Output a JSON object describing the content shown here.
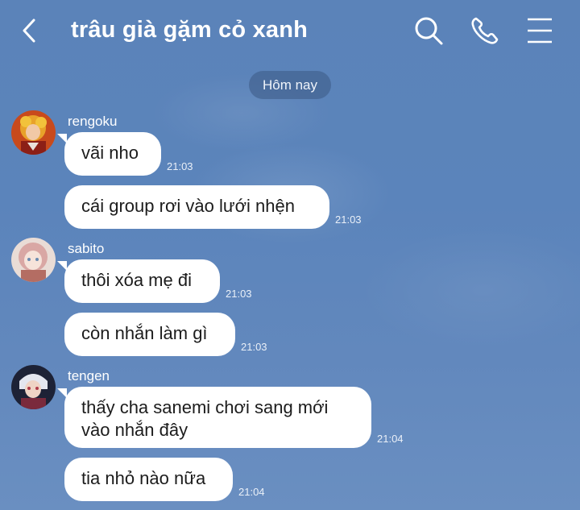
{
  "header": {
    "title": "trâu già gặm cỏ xanh",
    "icons": {
      "back": "chevron-left-icon",
      "search": "search-icon",
      "call": "phone-icon",
      "menu": "menu-icon"
    }
  },
  "date_divider": "Hôm nay",
  "messages": [
    {
      "sender": "rengoku",
      "text": "vãi nho",
      "time": "21:03"
    },
    {
      "text": "cái group rơi vào lưới nhện",
      "time": "21:03"
    },
    {
      "sender": "sabito",
      "text": "thôi xóa mẹ đi",
      "time": "21:03"
    },
    {
      "text": "còn nhắn làm gì",
      "time": "21:03"
    },
    {
      "sender": "tengen",
      "text_line1": "thấy cha sanemi chơi sang mới",
      "text_line2": "vào nhắn đây",
      "time": "21:04"
    },
    {
      "text": "tia nhỏ nào nữa",
      "time": "21:04"
    }
  ],
  "colors": {
    "background": "#5b84bb",
    "bubble": "#ffffff",
    "date_pill": "#405f8c"
  }
}
